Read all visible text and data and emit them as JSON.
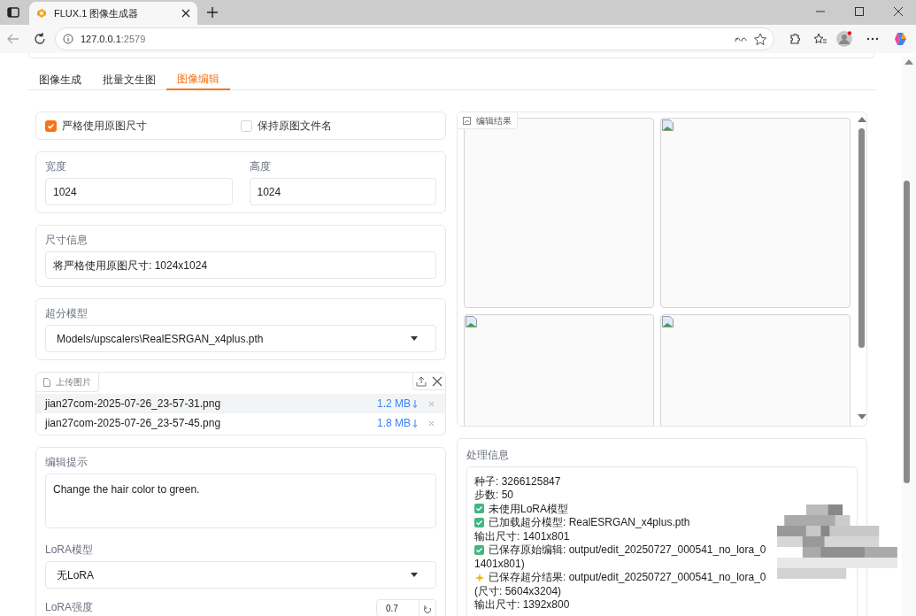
{
  "browser": {
    "tab_title": "FLUX.1 图像生成器",
    "url_host": "127.0.0.1",
    "url_port": ":2579"
  },
  "tabs": [
    {
      "label": "图像生成",
      "selected": false
    },
    {
      "label": "批量文生图",
      "selected": false
    },
    {
      "label": "图像编辑",
      "selected": true
    }
  ],
  "options": [
    {
      "label": "严格使用原图尺寸",
      "checked": true
    },
    {
      "label": "保持原图文件名",
      "checked": false
    }
  ],
  "width": {
    "label": "宽度",
    "value": "1024"
  },
  "height": {
    "label": "高度",
    "value": "1024"
  },
  "size_info": {
    "label": "尺寸信息",
    "value": "将严格使用原图尺寸: 1024x1024"
  },
  "upscaler": {
    "label": "超分模型",
    "value": "Models/upscalers\\RealESRGAN_x4plus.pth"
  },
  "upload": {
    "label": "上传图片",
    "files": [
      {
        "name": "jian27com-2025-07-26_23-57-31.png",
        "size": "1.2 MB",
        "hovered": true
      },
      {
        "name": "jian27com-2025-07-26_23-57-45.png",
        "size": "1.8 MB",
        "hovered": false
      }
    ]
  },
  "prompt": {
    "label": "编辑提示",
    "value": "Change the hair color to green."
  },
  "lora_model": {
    "label": "LoRA模型",
    "value": "无LoRA"
  },
  "lora_strength": {
    "label": "LoRA强度",
    "value": "0.7"
  },
  "gallery": {
    "label": "编辑结果",
    "images": [
      {
        "broken_icon": false
      },
      {
        "broken_icon": true
      },
      {
        "broken_icon": true
      },
      {
        "broken_icon": true
      }
    ]
  },
  "processing": {
    "label": "处理信息",
    "lines": [
      {
        "kind": "plain",
        "text": "种子: 3266125847"
      },
      {
        "kind": "plain",
        "text": "步数: 50"
      },
      {
        "kind": "success",
        "text": "未使用LoRA模型"
      },
      {
        "kind": "success",
        "text": "已加载超分模型: RealESRGAN_x4plus.pth"
      },
      {
        "kind": "plain",
        "text": "输出尺寸: 1401x801"
      },
      {
        "kind": "success",
        "text": "已保存原始编辑: output/edit_20250727_000541_no_lora_0"
      },
      {
        "kind": "plain",
        "text": "1401x801)"
      },
      {
        "kind": "highlight",
        "text": "已保存超分结果: output/edit_20250727_000541_no_lora_0"
      },
      {
        "kind": "plain",
        "text": "(尺寸: 5604x3204)"
      },
      {
        "kind": "plain",
        "text": "输出尺寸: 1392x800"
      }
    ]
  }
}
